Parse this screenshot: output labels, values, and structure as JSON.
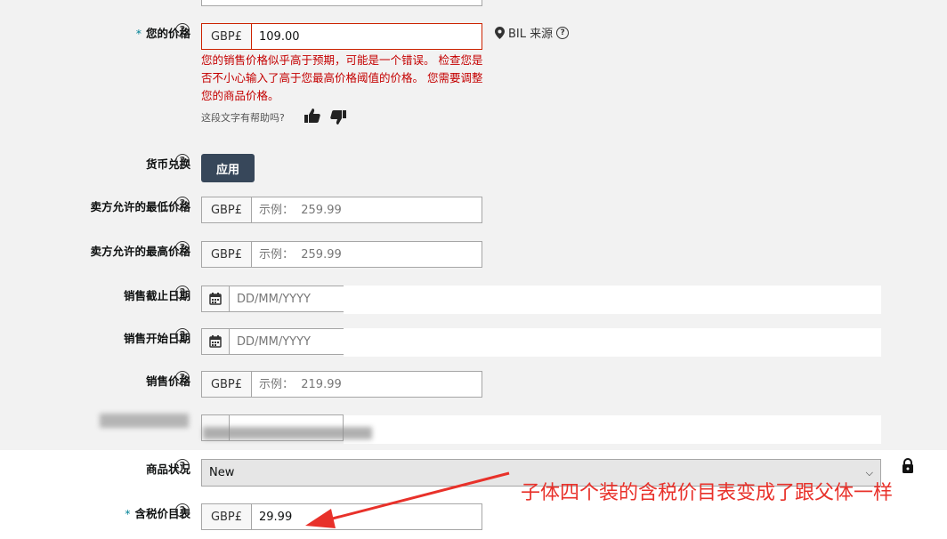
{
  "price_field": {
    "label": "您的价格",
    "required_mark": "*",
    "currency": "GBP£",
    "value": "109.00",
    "source_label": "BIL 来源",
    "error_message": "您的销售价格似乎高于预期，可能是一个错误。 检查您是否不小心输入了高于您最高价格阈值的价格。 您需要调整您的商品价格。",
    "helpful_question": "这段文字有帮助吗?"
  },
  "currency_conversion": {
    "label": "货币兑换",
    "button_label": "应用"
  },
  "min_price": {
    "label": "卖方允许的最低价格",
    "currency": "GBP£",
    "placeholder": "示例：  259.99"
  },
  "max_price": {
    "label": "卖方允许的最高价格",
    "currency": "GBP£",
    "placeholder": "示例：  259.99"
  },
  "sale_end_date": {
    "label": "销售截止日期",
    "placeholder": "DD/MM/YYYY"
  },
  "sale_start_date": {
    "label": "销售开始日期",
    "placeholder": "DD/MM/YYYY"
  },
  "sale_price": {
    "label": "销售价格",
    "currency": "GBP£",
    "placeholder": "示例：  219.99"
  },
  "condition": {
    "label": "商品状况",
    "selected": "New"
  },
  "list_price_tax": {
    "label": "含税价目表",
    "required_mark": "*",
    "currency": "GBP£",
    "value": "29.99"
  },
  "annotation": {
    "text": "子体四个装的含税价目表变成了跟父体一样",
    "color": "#e8312a"
  },
  "colors": {
    "error": "#c40000",
    "button": "#37475a",
    "required": "#008296"
  }
}
